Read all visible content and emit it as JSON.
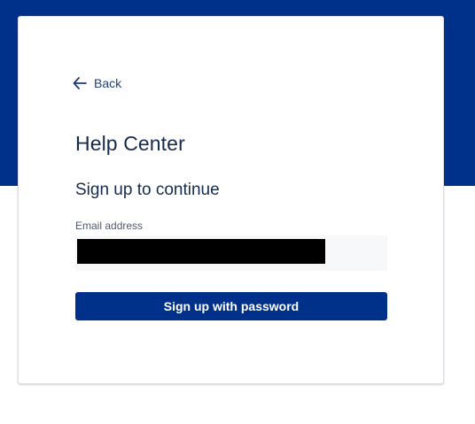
{
  "colors": {
    "brand": "#00318a",
    "text": "#172b4d",
    "link": "#1e3f7f",
    "field_bg": "#f7f8fa"
  },
  "nav": {
    "back_icon": "arrow-left-icon",
    "back_label": "Back"
  },
  "header": {
    "title": "Help Center",
    "subtitle": "Sign up to continue"
  },
  "form": {
    "email_label": "Email address",
    "email_value_redacted": true,
    "submit_label": "Sign up with password"
  }
}
